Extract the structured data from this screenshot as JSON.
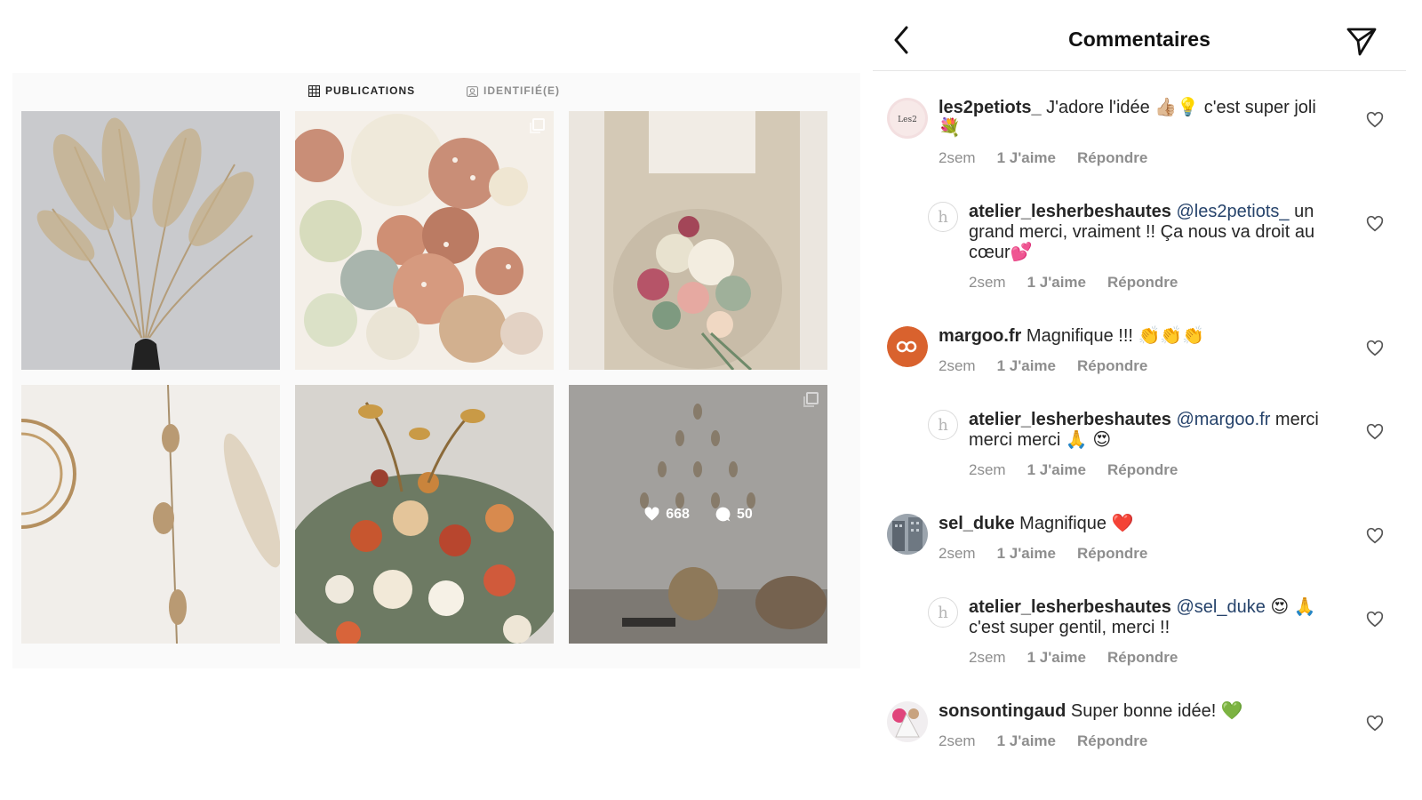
{
  "profile": {
    "tabs": [
      {
        "label": "PUBLICATIONS",
        "active": true
      },
      {
        "label": "IDENTIFIÉ(E)",
        "active": false
      }
    ],
    "hover_post": {
      "likes": "668",
      "comments": "50"
    }
  },
  "comments_panel": {
    "title": "Commentaires",
    "comments": [
      {
        "username": "les2petiots_",
        "text": "J'adore l'idée 👍🏼💡 c'est super joli 💐",
        "time": "2sem",
        "likes": "1 J'aime",
        "reply": "Répondre"
      },
      {
        "username": "atelier_lesherbeshautes",
        "mention": "@les2petiots_",
        "text": "un grand merci, vraiment !! Ça nous va droit au cœur💕",
        "time": "2sem",
        "likes": "1 J'aime",
        "reply": "Répondre"
      },
      {
        "username": "margoo.fr",
        "text": "Magnifique !!! 👏👏👏",
        "time": "2sem",
        "likes": "1 J'aime",
        "reply": "Répondre"
      },
      {
        "username": "atelier_lesherbeshautes",
        "mention": "@margoo.fr",
        "text": "merci merci merci 🙏 😍",
        "time": "2sem",
        "likes": "1 J'aime",
        "reply": "Répondre"
      },
      {
        "username": "sel_duke",
        "text": "Magnifique ❤️",
        "time": "2sem",
        "likes": "1 J'aime",
        "reply": "Répondre"
      },
      {
        "username": "atelier_lesherbeshautes",
        "mention": "@sel_duke",
        "text": "😍 🙏 c'est super gentil, merci !!",
        "time": "2sem",
        "likes": "1 J'aime",
        "reply": "Répondre"
      },
      {
        "username": "sonsontingaud",
        "text": "Super bonne idée! 💚",
        "time": "2sem",
        "likes": "1 J'aime",
        "reply": "Répondre"
      }
    ]
  },
  "colors": {
    "mention": "#26436b",
    "meta": "#8e8e8e",
    "text": "#262626"
  },
  "icons": [
    "grid-icon",
    "tag-icon",
    "back-arrow-icon",
    "send-icon",
    "heart-icon",
    "comment-bubble-icon",
    "multi-photo-icon"
  ]
}
